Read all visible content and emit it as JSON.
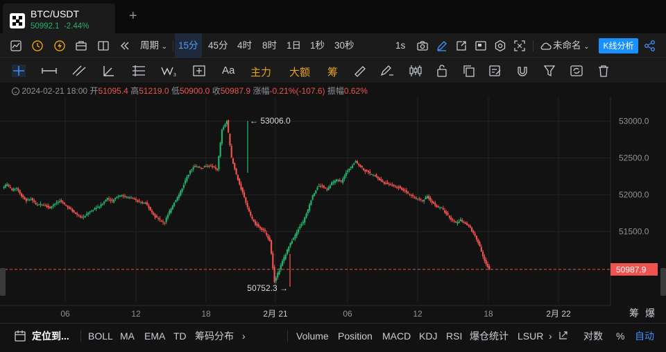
{
  "tab": {
    "title": "BTC/USDT",
    "price": "50992.1",
    "change": "-2.44%",
    "add": "+"
  },
  "toolbar1": {
    "period_label": "周期",
    "periods": [
      "15分",
      "45分",
      "4时",
      "8时",
      "1日",
      "1秒",
      "30秒"
    ],
    "selected_period": "15分",
    "interval": "1s",
    "layout_name": "未命名",
    "kline_analysis": "K线分析"
  },
  "toolbar2": {
    "main": "主力",
    "big": "大额",
    "chips": "筹",
    "font": "Aa"
  },
  "ohlc": {
    "date": "2024-02-21 18:00",
    "open_label": "开",
    "open": "51095.4",
    "high_label": "高",
    "high": "51219.0",
    "low_label": "低",
    "low": "50900.0",
    "close_label": "收",
    "close": "50987.9",
    "change_label": "涨幅",
    "change": "-0.21%(-107.6)",
    "amp_label": "振幅",
    "amp": "0.62%"
  },
  "chart_data": {
    "type": "candlestick",
    "y_ticks": [
      "53000.0",
      "52500.0",
      "52000.0",
      "51500.0"
    ],
    "x_ticks": [
      "06",
      "12",
      "18",
      "2月 21",
      "06",
      "12",
      "18",
      "2月 22"
    ],
    "high_marker": "← 53006.0",
    "low_marker": "50752.3 →",
    "last_price": "50987.9",
    "ylim": [
      50700,
      53200
    ],
    "close_series": [
      52140,
      52060,
      52100,
      51990,
      51920,
      51940,
      51870,
      51880,
      51860,
      51820,
      51880,
      51910,
      51870,
      51820,
      51760,
      51720,
      51700,
      51760,
      51790,
      51840,
      51880,
      51960,
      51920,
      51980,
      52000,
      51970,
      51960,
      51930,
      51900,
      51880,
      51800,
      51700,
      51660,
      51620,
      51780,
      51900,
      52000,
      52140,
      52280,
      52380,
      52380,
      52360,
      52400,
      52380,
      52340,
      52880,
      53000,
      52500,
      52280,
      52080,
      51900,
      51720,
      51600,
      51550,
      51500,
      51380,
      50820,
      50980,
      51150,
      51300,
      51420,
      51540,
      51640,
      51800,
      52000,
      52100,
      52120,
      52060,
      52160,
      52200,
      52180,
      52300,
      52380,
      52460,
      52380,
      52320,
      52300,
      52260,
      52200,
      52160,
      52140,
      52120,
      52100,
      52060,
      52020,
      51980,
      51940,
      51920,
      51980,
      51900,
      51840,
      51820,
      51740,
      51660,
      51620,
      51660,
      51600,
      51560,
      51440,
      51300,
      51100,
      50988
    ]
  },
  "bottombar": {
    "locate": "定位到...",
    "indicators_left": [
      "BOLL",
      "MA",
      "EMA",
      "TD",
      "筹码分布"
    ],
    "indicators_right": [
      "Volume",
      "Position",
      "MACD",
      "KDJ",
      "RSI",
      "爆仓统计",
      "LSUR"
    ],
    "log": "对数",
    "pct": "%",
    "auto": "自动",
    "right_tabs": [
      "筹",
      "爆"
    ]
  },
  "colors": {
    "up": "#23b26d",
    "down": "#ef5350",
    "accent": "#1890ff",
    "bg": "#121212"
  }
}
